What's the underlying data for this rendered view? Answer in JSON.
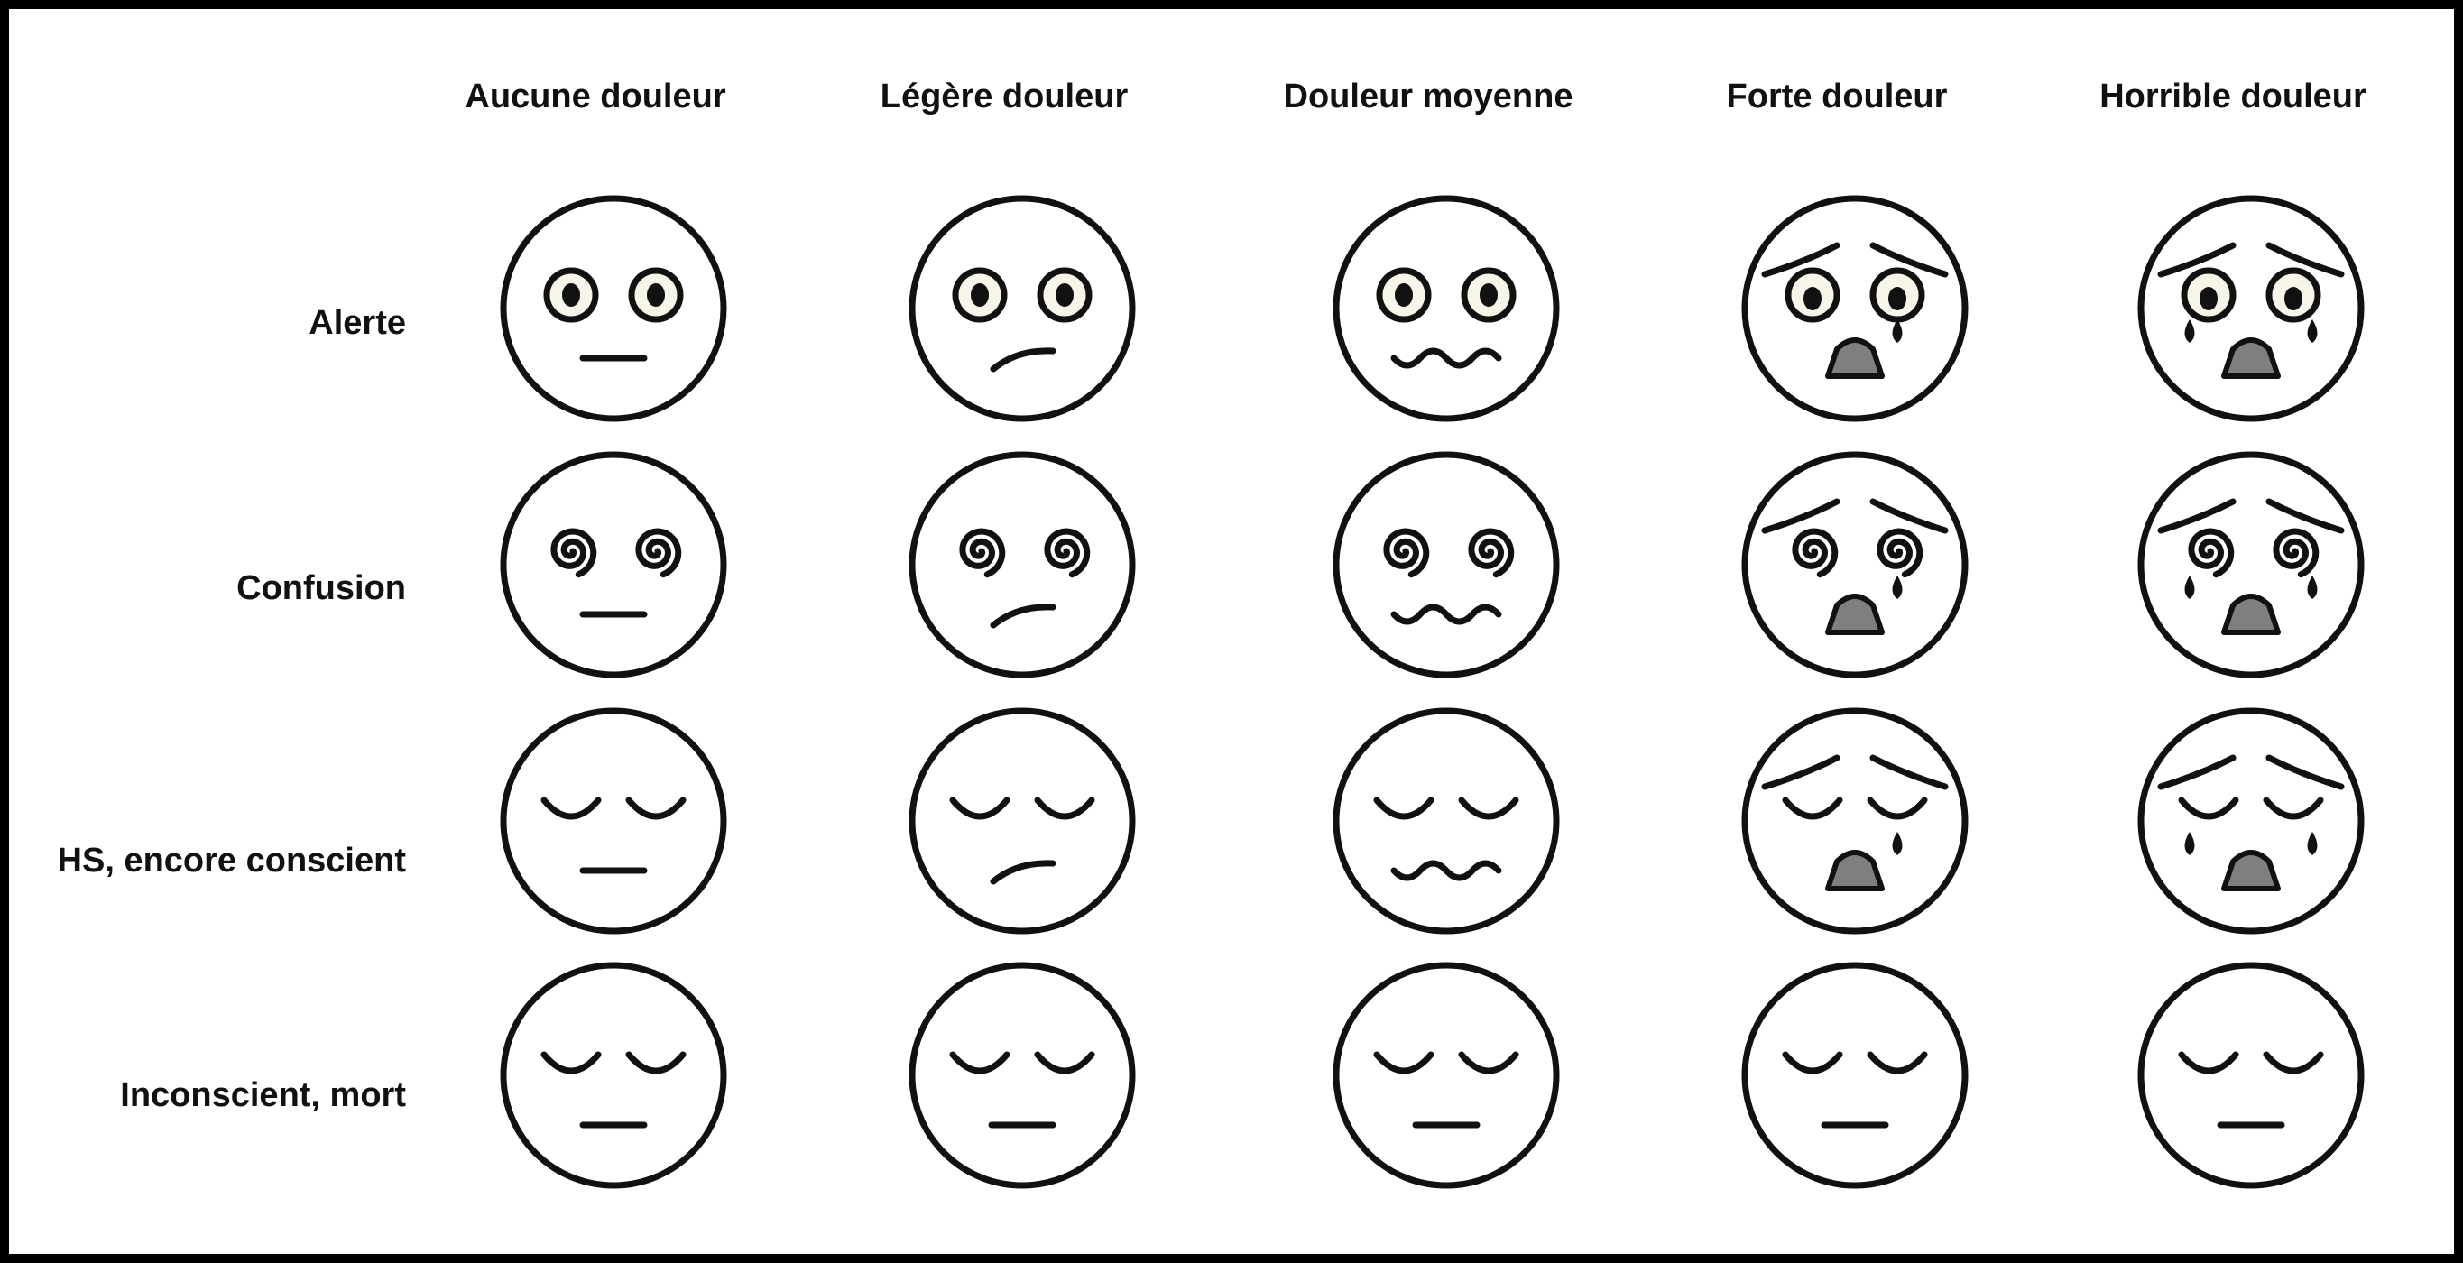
{
  "columns": [
    {
      "label": "Aucune douleur"
    },
    {
      "label": "Légère douleur"
    },
    {
      "label": "Douleur moyenne"
    },
    {
      "label": "Forte douleur"
    },
    {
      "label": "Horrible douleur"
    }
  ],
  "rows": [
    {
      "label": "Alerte",
      "eyes": "open"
    },
    {
      "label": "Confusion",
      "eyes": "spiral"
    },
    {
      "label": "HS, encore conscient",
      "eyes": "closed"
    },
    {
      "label": "Inconscient, mort",
      "eyes": "closed"
    }
  ],
  "pain_mouths": [
    "flat",
    "crooked",
    "wavy",
    "open-sad",
    "open-sad"
  ],
  "pain_brows": [
    false,
    false,
    false,
    true,
    true
  ],
  "pain_tears": [
    0,
    0,
    0,
    1,
    2
  ],
  "colors": {
    "stroke": "#111111",
    "eye_fill": "#f7f4e8",
    "mouth_fill": "#7f7f7f",
    "face_fill": "#ffffff"
  }
}
